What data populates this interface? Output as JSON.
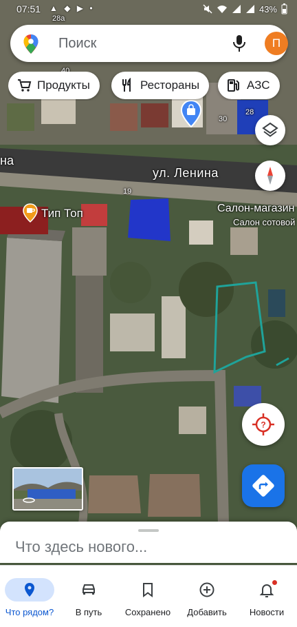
{
  "status_bar": {
    "time": "07:51",
    "left_icons": "▲ ◆ ▶ •",
    "battery": "43%"
  },
  "search": {
    "placeholder": "Поиск",
    "avatar_letter": "П"
  },
  "chips": [
    {
      "label": "Продукты",
      "icon": "cart-icon"
    },
    {
      "label": "Рестораны",
      "icon": "restaurant-icon"
    },
    {
      "label": "АЗС",
      "icon": "gas-station-icon"
    }
  ],
  "map": {
    "street_label": "ул. Ленина",
    "street_label_left": "на",
    "poi_label": "Тип Топ",
    "shop_label": "Салон-магазин",
    "shop_sublabel": "Салон сотовой",
    "house_numbers": [
      "28а",
      "19",
      "30",
      "28",
      "40"
    ]
  },
  "sheet": {
    "title": "Что здесь нового..."
  },
  "nav": [
    {
      "label": "Что рядом?",
      "icon": "location-pin-icon",
      "active": true
    },
    {
      "label": "В путь",
      "icon": "car-icon",
      "active": false
    },
    {
      "label": "Сохранено",
      "icon": "bookmark-icon",
      "active": false
    },
    {
      "label": "Добавить",
      "icon": "add-circle-icon",
      "active": false
    },
    {
      "label": "Новости",
      "icon": "bell-icon",
      "active": false
    }
  ],
  "colors": {
    "accent": "#1a73e8",
    "avatar": "#ef7d22",
    "nav_active_bg": "#d3e3fd"
  }
}
